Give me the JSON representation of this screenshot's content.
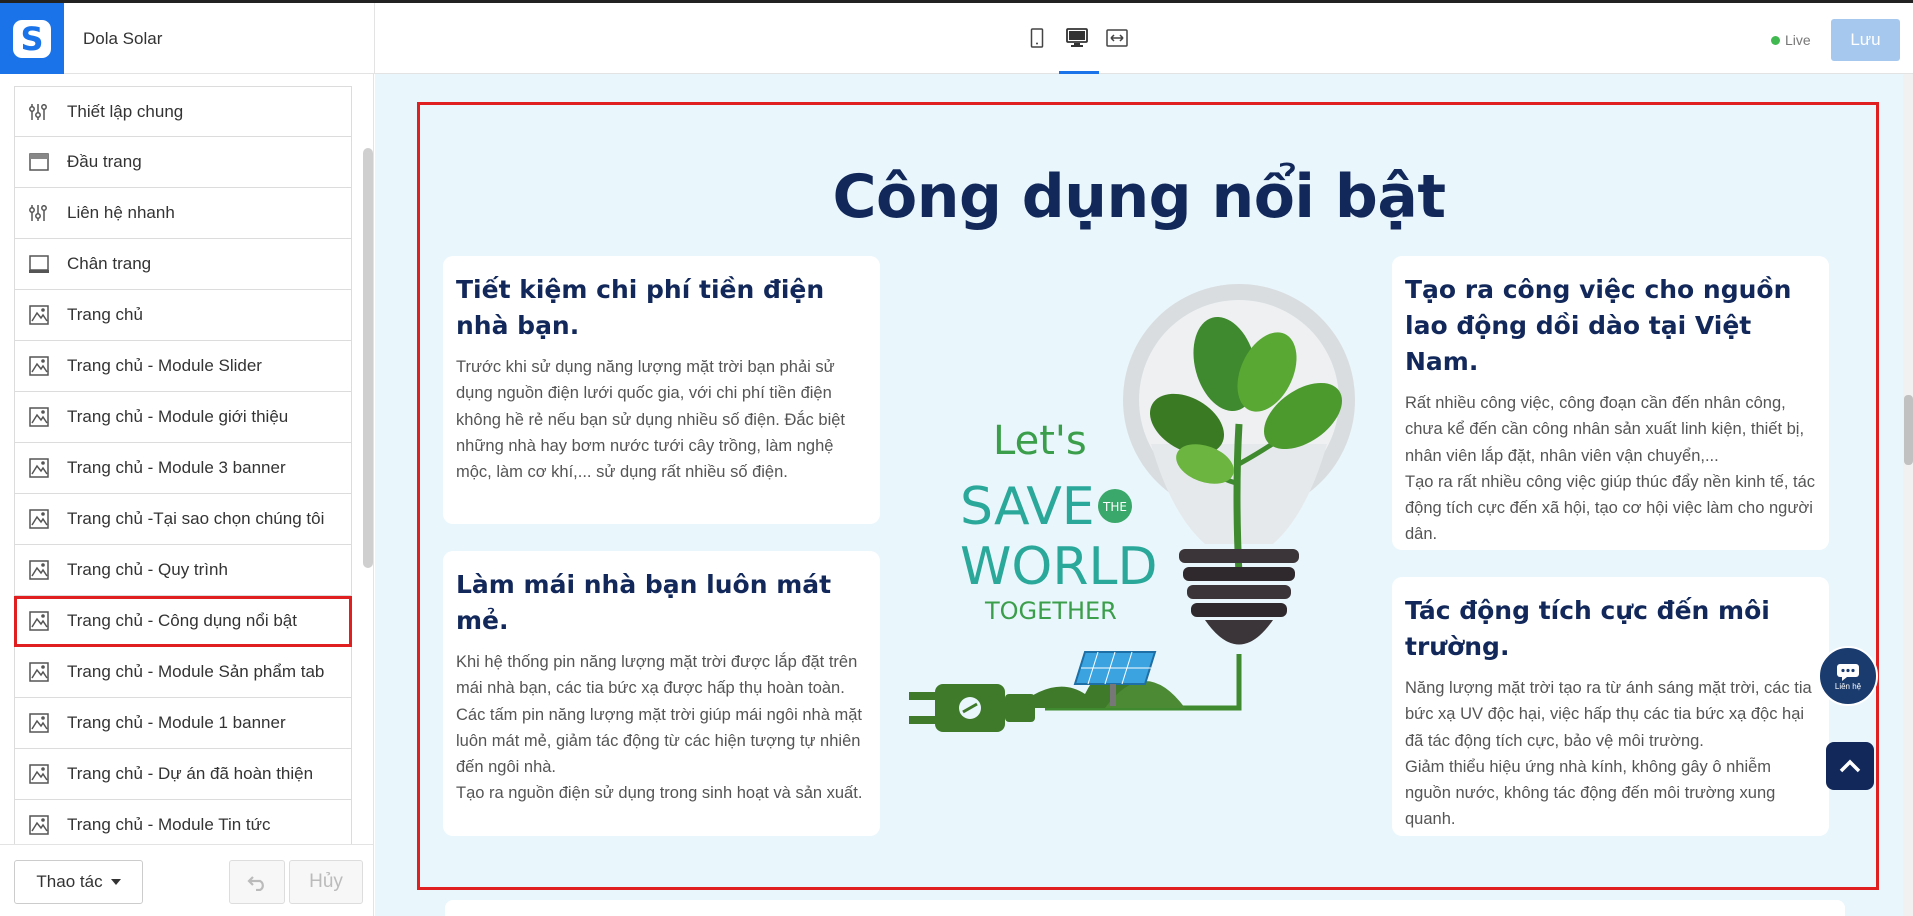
{
  "header": {
    "site_name": "Dola Solar",
    "live_label": "Live",
    "save_label": "Lưu",
    "device_icons": [
      "mobile-icon",
      "desktop-icon",
      "fullwidth-icon"
    ],
    "accent_color": "#1a73e8"
  },
  "sidebar": {
    "items": [
      {
        "label": "Thiết lập chung",
        "icon": "settings-sliders-icon"
      },
      {
        "label": "Đầu trang",
        "icon": "header-layout-icon"
      },
      {
        "label": "Liên hệ nhanh",
        "icon": "settings-sliders-icon"
      },
      {
        "label": "Chân trang",
        "icon": "footer-layout-icon"
      },
      {
        "label": "Trang chủ",
        "icon": "page-image-icon"
      },
      {
        "label": "Trang chủ - Module Slider",
        "icon": "page-image-icon"
      },
      {
        "label": "Trang chủ - Module giới thiệu",
        "icon": "page-image-icon"
      },
      {
        "label": "Trang chủ - Module 3 banner",
        "icon": "page-image-icon"
      },
      {
        "label": "Trang chủ -Tại sao chọn chúng tôi",
        "icon": "page-image-icon"
      },
      {
        "label": "Trang chủ - Quy trình",
        "icon": "page-image-icon"
      },
      {
        "label": "Trang chủ - Công dụng nổi bật",
        "icon": "page-image-icon",
        "active": true
      },
      {
        "label": "Trang chủ - Module Sản phẩm tab",
        "icon": "page-image-icon"
      },
      {
        "label": "Trang chủ - Module 1 banner",
        "icon": "page-image-icon"
      },
      {
        "label": "Trang chủ - Dự án đã hoàn thiện",
        "icon": "page-image-icon"
      },
      {
        "label": "Trang chủ - Module Tin tức",
        "icon": "page-image-icon"
      }
    ],
    "actions_label": "Thao tác",
    "cancel_label": "Hủy"
  },
  "preview": {
    "section_title": "Công dụng nổi bật",
    "cards": [
      {
        "title": "Tiết kiệm chi phí tiền điện nhà bạn.",
        "body": "Trước khi sử dụng năng lượng mặt trời bạn phải sử dụng nguồn điện lưới quốc gia, với chi phí tiền điện không hề rẻ nếu bạn sử dụng nhiều số điện. Đắc biệt những nhà hay bơm nước tưới cây trồng, làm nghệ mộc, làm cơ khí,... sử dụng rất nhiều số điện."
      },
      {
        "title": "Làm mái nhà bạn luôn mát mẻ.",
        "body": "Khi hệ thống pin năng lượng mặt trời được lắp đặt trên mái nhà bạn, các tia bức xạ được hấp thụ hoàn toàn.\nCác tấm pin năng lượng mặt trời giúp mái ngôi nhà mặt luôn mát mẻ, giảm tác động từ các hiện tượng tự nhiên đến ngôi nhà.\nTạo ra nguồn điện sử dụng trong sinh hoạt và sản xuất."
      },
      {
        "title": "Tạo ra công việc cho nguồn lao động dồi dào tại Việt Nam.",
        "body": "Rất nhiều công việc, công đoạn cần đến nhân công, chưa kể đến cần công nhân sản xuất linh kiện, thiết bị, nhân viên lắp đặt, nhân viên vận chuyển,...\nTạo ra rất nhiều công việc giúp thúc đẩy nền kinh tế, tác động tích cực đến xã hội, tạo cơ hội việc làm cho người dân."
      },
      {
        "title": "Tác động tích cực đến môi trường.",
        "body": "Năng lượng mặt trời tạo ra từ ánh sáng mặt trời, các tia bức xạ UV độc hại, việc hấp thụ các tia bức xạ độc hại đã tác động tích cực, bảo vệ môi trường.\nGiảm thiểu hiệu ứng nhà kính, không gây ô nhiễm nguồn nước, không tác động đến môi trường xung quanh."
      }
    ],
    "illustration": {
      "line1": "Let's",
      "line2": "SAVE",
      "badge": "THE",
      "line3": "WORLD",
      "line4": "TOGETHER"
    },
    "chat_label": "Liên hệ",
    "title_color": "#12285a",
    "background_color": "#e9f6fc",
    "highlight_color": "#e02020"
  }
}
